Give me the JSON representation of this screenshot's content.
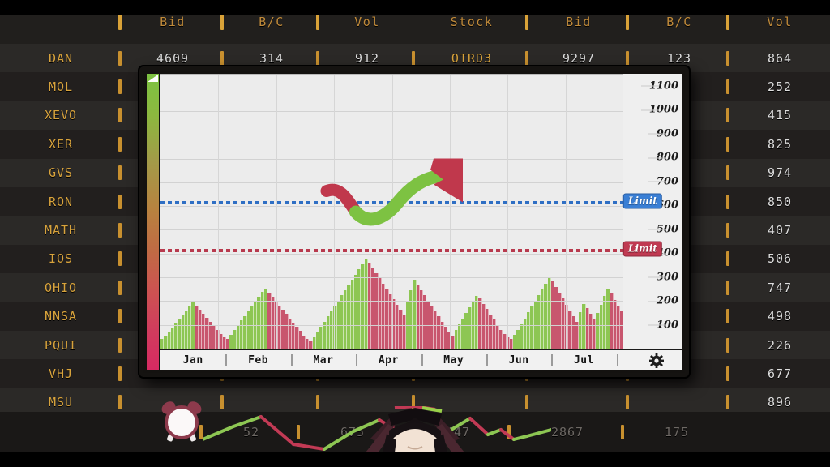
{
  "window": {
    "title": "stock-terminal"
  },
  "left_table": {
    "headers": [
      "",
      "Bid",
      "B/C",
      "Vol"
    ],
    "rows": [
      {
        "sym": "DAN",
        "bid": "4609",
        "bc": "314",
        "vol": "912"
      },
      {
        "sym": "MOL",
        "bid": "",
        "bc": "",
        "vol": ""
      },
      {
        "sym": "XEVO",
        "bid": "",
        "bc": "",
        "vol": ""
      },
      {
        "sym": "XER",
        "bid": "",
        "bc": "",
        "vol": ""
      },
      {
        "sym": "GVS",
        "bid": "",
        "bc": "",
        "vol": ""
      },
      {
        "sym": "RON",
        "bid": "",
        "bc": "",
        "vol": ""
      },
      {
        "sym": "MATH",
        "bid": "",
        "bc": "",
        "vol": ""
      },
      {
        "sym": "IOS",
        "bid": "",
        "bc": "",
        "vol": ""
      },
      {
        "sym": "OHIO",
        "bid": "",
        "bc": "",
        "vol": ""
      },
      {
        "sym": "NNSA",
        "bid": "",
        "bc": "",
        "vol": ""
      },
      {
        "sym": "PQUI",
        "bid": "",
        "bc": "",
        "vol": ""
      },
      {
        "sym": "VHJ",
        "bid": "",
        "bc": "",
        "vol": ""
      },
      {
        "sym": "MSU",
        "bid": "",
        "bc": "",
        "vol": ""
      }
    ]
  },
  "right_table": {
    "headers": [
      "Stock",
      "Bid",
      "B/C",
      "Vol"
    ],
    "rows": [
      {
        "sym": "OTRD3",
        "bid": "9297",
        "bc": "123",
        "vol": "864"
      },
      {
        "sym": "",
        "bid": "",
        "bc": "",
        "vol": "252"
      },
      {
        "sym": "",
        "bid": "",
        "bc": "",
        "vol": "415"
      },
      {
        "sym": "",
        "bid": "",
        "bc": "",
        "vol": "825"
      },
      {
        "sym": "",
        "bid": "",
        "bc": "",
        "vol": "974"
      },
      {
        "sym": "",
        "bid": "",
        "bc": "",
        "vol": "850"
      },
      {
        "sym": "",
        "bid": "",
        "bc": "",
        "vol": "407"
      },
      {
        "sym": "",
        "bid": "",
        "bc": "",
        "vol": "506"
      },
      {
        "sym": "",
        "bid": "",
        "bc": "",
        "vol": "747"
      },
      {
        "sym": "",
        "bid": "",
        "bc": "",
        "vol": "498"
      },
      {
        "sym": "",
        "bid": "",
        "bc": "",
        "vol": "226"
      },
      {
        "sym": "",
        "bid": "",
        "bc": "",
        "vol": "677"
      },
      {
        "sym": "",
        "bid": "",
        "bc": "",
        "vol": "896"
      }
    ]
  },
  "ticker": {
    "clock_icon": "alarm-clock-icon",
    "values": [
      "52",
      "675",
      "447",
      "2867",
      "175"
    ]
  },
  "chart_data": {
    "type": "bar",
    "title": "",
    "xlabel": "",
    "ylabel": "",
    "grid": true,
    "ylim": [
      0,
      1150
    ],
    "yticks": [
      1100,
      1000,
      900,
      800,
      700,
      600,
      500,
      400,
      300,
      200,
      100
    ],
    "categories": [
      "Jan",
      "Feb",
      "Mar",
      "Apr",
      "May",
      "Jun",
      "Jul"
    ],
    "values": [
      40,
      55,
      70,
      88,
      105,
      125,
      145,
      162,
      180,
      196,
      182,
      165,
      148,
      130,
      112,
      95,
      78,
      62,
      48,
      40,
      58,
      78,
      98,
      118,
      138,
      158,
      178,
      198,
      218,
      238,
      252,
      236,
      218,
      200,
      182,
      164,
      146,
      128,
      110,
      92,
      74,
      56,
      40,
      30,
      48,
      70,
      92,
      114,
      136,
      158,
      180,
      202,
      224,
      246,
      268,
      290,
      312,
      334,
      356,
      378,
      362,
      340,
      318,
      296,
      274,
      252,
      230,
      208,
      186,
      164,
      142,
      196,
      246,
      290,
      268,
      246,
      224,
      202,
      180,
      158,
      136,
      114,
      92,
      70,
      55,
      78,
      102,
      126,
      150,
      174,
      198,
      222,
      210,
      188,
      166,
      144,
      122,
      100,
      80,
      62,
      48,
      40,
      58,
      80,
      104,
      128,
      152,
      176,
      200,
      224,
      248,
      272,
      296,
      282,
      258,
      234,
      210,
      186,
      162,
      138,
      114,
      152,
      188,
      170,
      148,
      126,
      150,
      186,
      222,
      250,
      232,
      206,
      180,
      156
    ],
    "bar_up_color": "#8dc653",
    "bar_down_color": "#c8566e",
    "limits": [
      {
        "label": "Limit",
        "value": 620,
        "color": "#3a7fd5",
        "style": "dotted"
      },
      {
        "label": "Limit",
        "value": 420,
        "color": "#c03a52",
        "style": "dotted"
      }
    ],
    "annotations": [
      {
        "name": "trend-arrow",
        "shape": "curved-arrow",
        "from_color": "#c0384c",
        "to_color": "#7dc242"
      }
    ],
    "gauge": {
      "top_color": "#7dc242",
      "bottom_color": "#d62a62",
      "marker": "triangle"
    },
    "settings_icon": "gear-icon"
  },
  "colors": {
    "accent_gold": "#c8902f",
    "panel_dark": "#211f1d",
    "row_odd": "#2b2927",
    "row_even": "#221f1e",
    "plot_bg": "#ececec"
  }
}
